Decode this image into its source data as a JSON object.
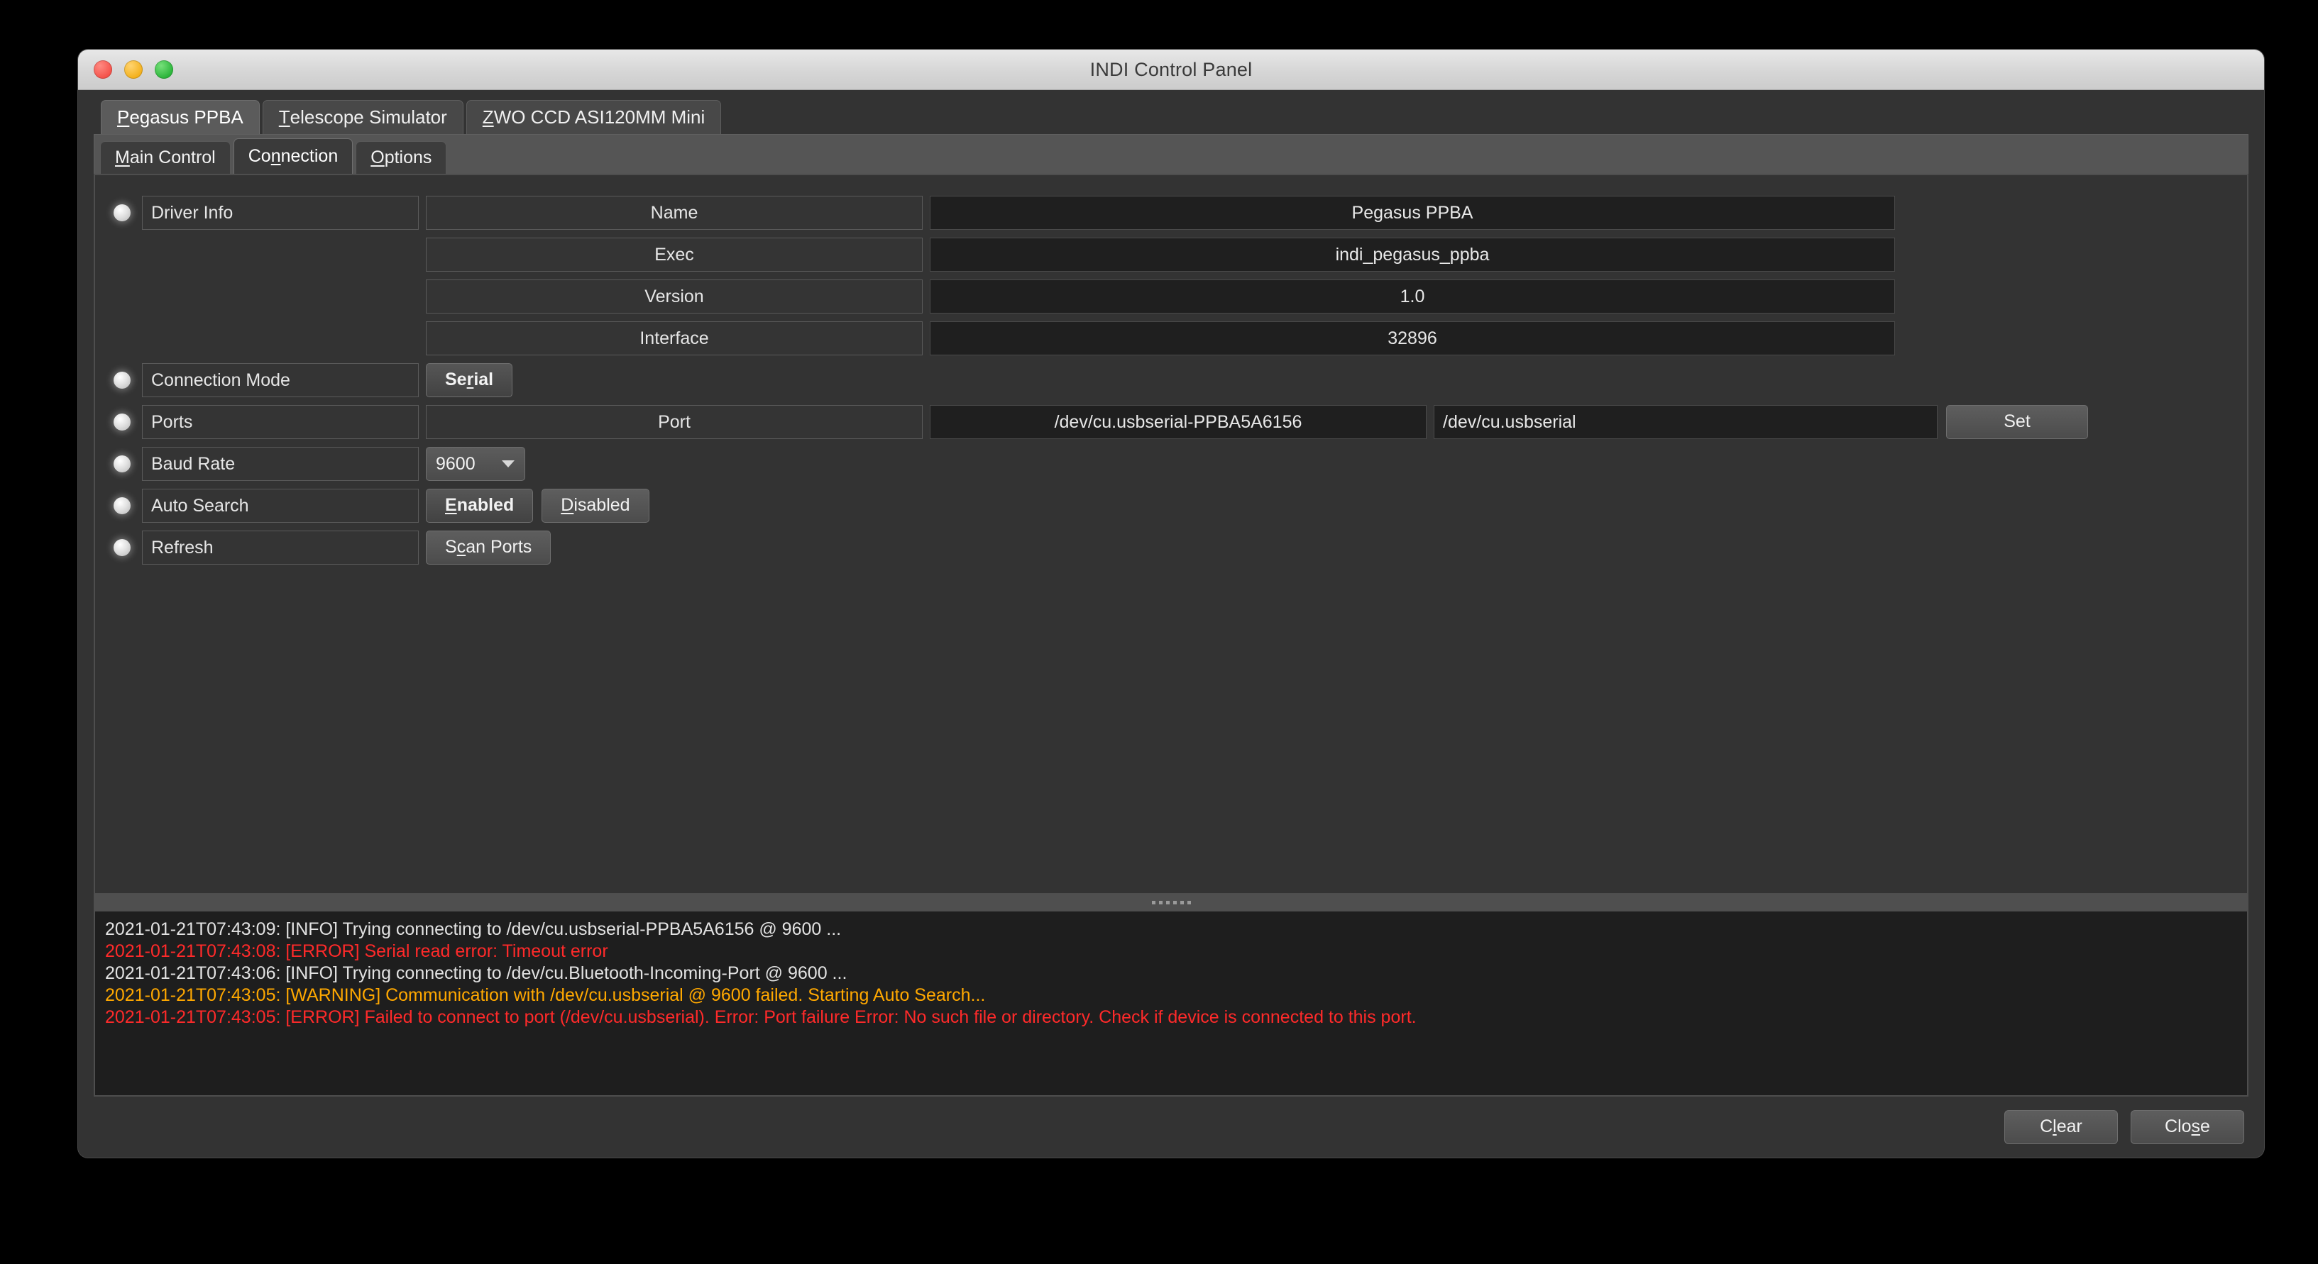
{
  "window": {
    "title": "INDI Control Panel",
    "traffic_lights": [
      "close-button",
      "minimize-button",
      "zoom-button"
    ]
  },
  "device_tabs": [
    {
      "label": "Pegasus PPBA",
      "mnemonic": "P",
      "active": true
    },
    {
      "label": "Telescope Simulator",
      "mnemonic": "T",
      "active": false
    },
    {
      "label": "ZWO CCD ASI120MM Mini",
      "mnemonic": "Z",
      "active": false
    }
  ],
  "sub_tabs": [
    {
      "label": "Main Control",
      "mnemonic": "M",
      "active": false
    },
    {
      "label": "Connection",
      "mnemonic": "n",
      "active": true
    },
    {
      "label": "Options",
      "mnemonic": "O",
      "active": false
    }
  ],
  "properties": {
    "driver_info": {
      "label": "Driver Info",
      "rows": [
        {
          "name": "Name",
          "value": "Pegasus PPBA"
        },
        {
          "name": "Exec",
          "value": "indi_pegasus_ppba"
        },
        {
          "name": "Version",
          "value": "1.0"
        },
        {
          "name": "Interface",
          "value": "32896"
        }
      ]
    },
    "connection_mode": {
      "label": "Connection Mode",
      "buttons": [
        {
          "label": "Serial",
          "mnemonic": "r",
          "selected": true
        }
      ]
    },
    "ports": {
      "label": "Ports",
      "field_name": "Port",
      "current_value": "/dev/cu.usbserial-PPBA5A6156",
      "edit_value": "/dev/cu.usbserial",
      "set_label": "Set"
    },
    "baud_rate": {
      "label": "Baud Rate",
      "selected": "9600"
    },
    "auto_search": {
      "label": "Auto Search",
      "buttons": [
        {
          "label": "Enabled",
          "mnemonic": "E",
          "selected": true
        },
        {
          "label": "Disabled",
          "mnemonic": "D",
          "selected": false
        }
      ]
    },
    "refresh": {
      "label": "Refresh",
      "buttons": [
        {
          "label": "Scan Ports",
          "mnemonic": "c",
          "selected": false
        }
      ]
    }
  },
  "log": {
    "lines": [
      {
        "text": "2021-01-21T07:43:09: [INFO] Trying connecting to /dev/cu.usbserial-PPBA5A6156 @ 9600 ...",
        "level": "info"
      },
      {
        "text": "2021-01-21T07:43:08: [ERROR] Serial read error: Timeout error",
        "level": "error"
      },
      {
        "text": "2021-01-21T07:43:06: [INFO] Trying connecting to /dev/cu.Bluetooth-Incoming-Port @ 9600 ...",
        "level": "info"
      },
      {
        "text": "2021-01-21T07:43:05: [WARNING] Communication with /dev/cu.usbserial @ 9600 failed. Starting Auto Search...",
        "level": "warning"
      },
      {
        "text": "2021-01-21T07:43:05: [ERROR] Failed to connect to port (/dev/cu.usbserial). Error: Port failure Error: No such file or directory. Check if device is connected to this port.",
        "level": "error"
      }
    ]
  },
  "footer": {
    "clear_label": "Clear",
    "clear_mnemonic": "l",
    "close_label": "Close",
    "close_mnemonic": "s"
  },
  "colors": {
    "error": "#ff2a2a",
    "warning": "#ffa800",
    "info": "#e2e2e2",
    "window_bg": "#333333",
    "log_bg": "#1e1e1e"
  }
}
